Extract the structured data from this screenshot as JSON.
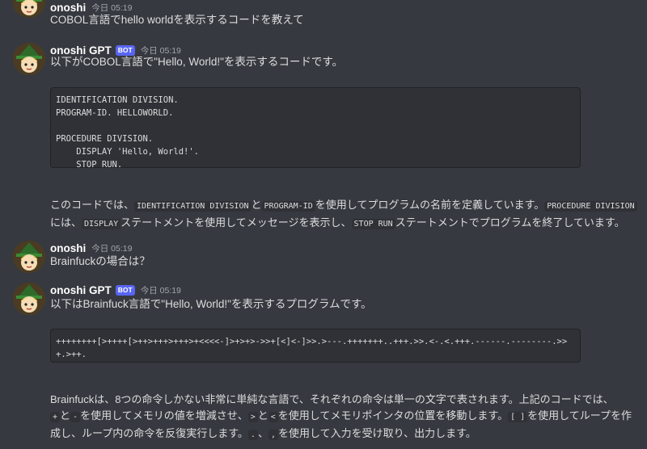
{
  "messages": [
    {
      "username": "onoshi",
      "timestamp": "今日 05:19",
      "text": "COBOL言語でhello worldを表示するコードを教えて"
    },
    {
      "username": "onoshi GPT",
      "bot_tag": "BOT",
      "timestamp": "今日 05:19",
      "text": "以下がCOBOL言語で\"Hello, World!\"を表示するコードです。",
      "code": "IDENTIFICATION DIVISION.\nPROGRAM-ID. HELLOWORLD.\n\nPROCEDURE DIVISION.\n    DISPLAY 'Hello, World!'.\n    STOP RUN.",
      "explanation": {
        "t1": "このコードでは、",
        "c1": "IDENTIFICATION DIVISION",
        "t2": "と",
        "c2": "PROGRAM-ID",
        "t3": "を使用してプログラムの名前を定義しています。",
        "c3": "PROCEDURE DIVISION",
        "t4": "には、",
        "c4": "DISPLAY",
        "t5": "ステートメントを使用してメッセージを表示し、",
        "c5": "STOP RUN",
        "t6": "ステートメントでプログラムを終了しています。"
      }
    },
    {
      "username": "onoshi",
      "timestamp": "今日 05:19",
      "text": "Brainfuckの場合は？"
    },
    {
      "username": "onoshi GPT",
      "bot_tag": "BOT",
      "timestamp": "今日 05:19",
      "text": "以下はBrainfuck言語で\"Hello, World!\"を表示するプログラムです。",
      "code": "++++++++[>++++[>++>+++>+++>+<<<<-]>+>+>->>+[<]<-]>>.>---.+++++++..+++.>>.<-.<.+++.------.--------.>>+.>++.",
      "explanation": {
        "t1": "Brainfuckは、8つの命令しかない非常に単純な言語で、それぞれの命令は単一の文字で表されます。上記のコードでは、",
        "c1": "+",
        "t2": "と",
        "c2": "-",
        "t3": "を使用してメモリの値を増減させ、",
        "c3": ">",
        "t4": "と",
        "c4": "<",
        "t5": "を使用してメモリポインタの位置を移動します。",
        "c5": "[ ]",
        "t6": "を使用してループを作成し、ループ内の命令を反復実行します。",
        "c6": ".",
        "t7": "、",
        "c7": ",",
        "t8": "を使用して入力を受け取り、出力します。"
      }
    }
  ]
}
